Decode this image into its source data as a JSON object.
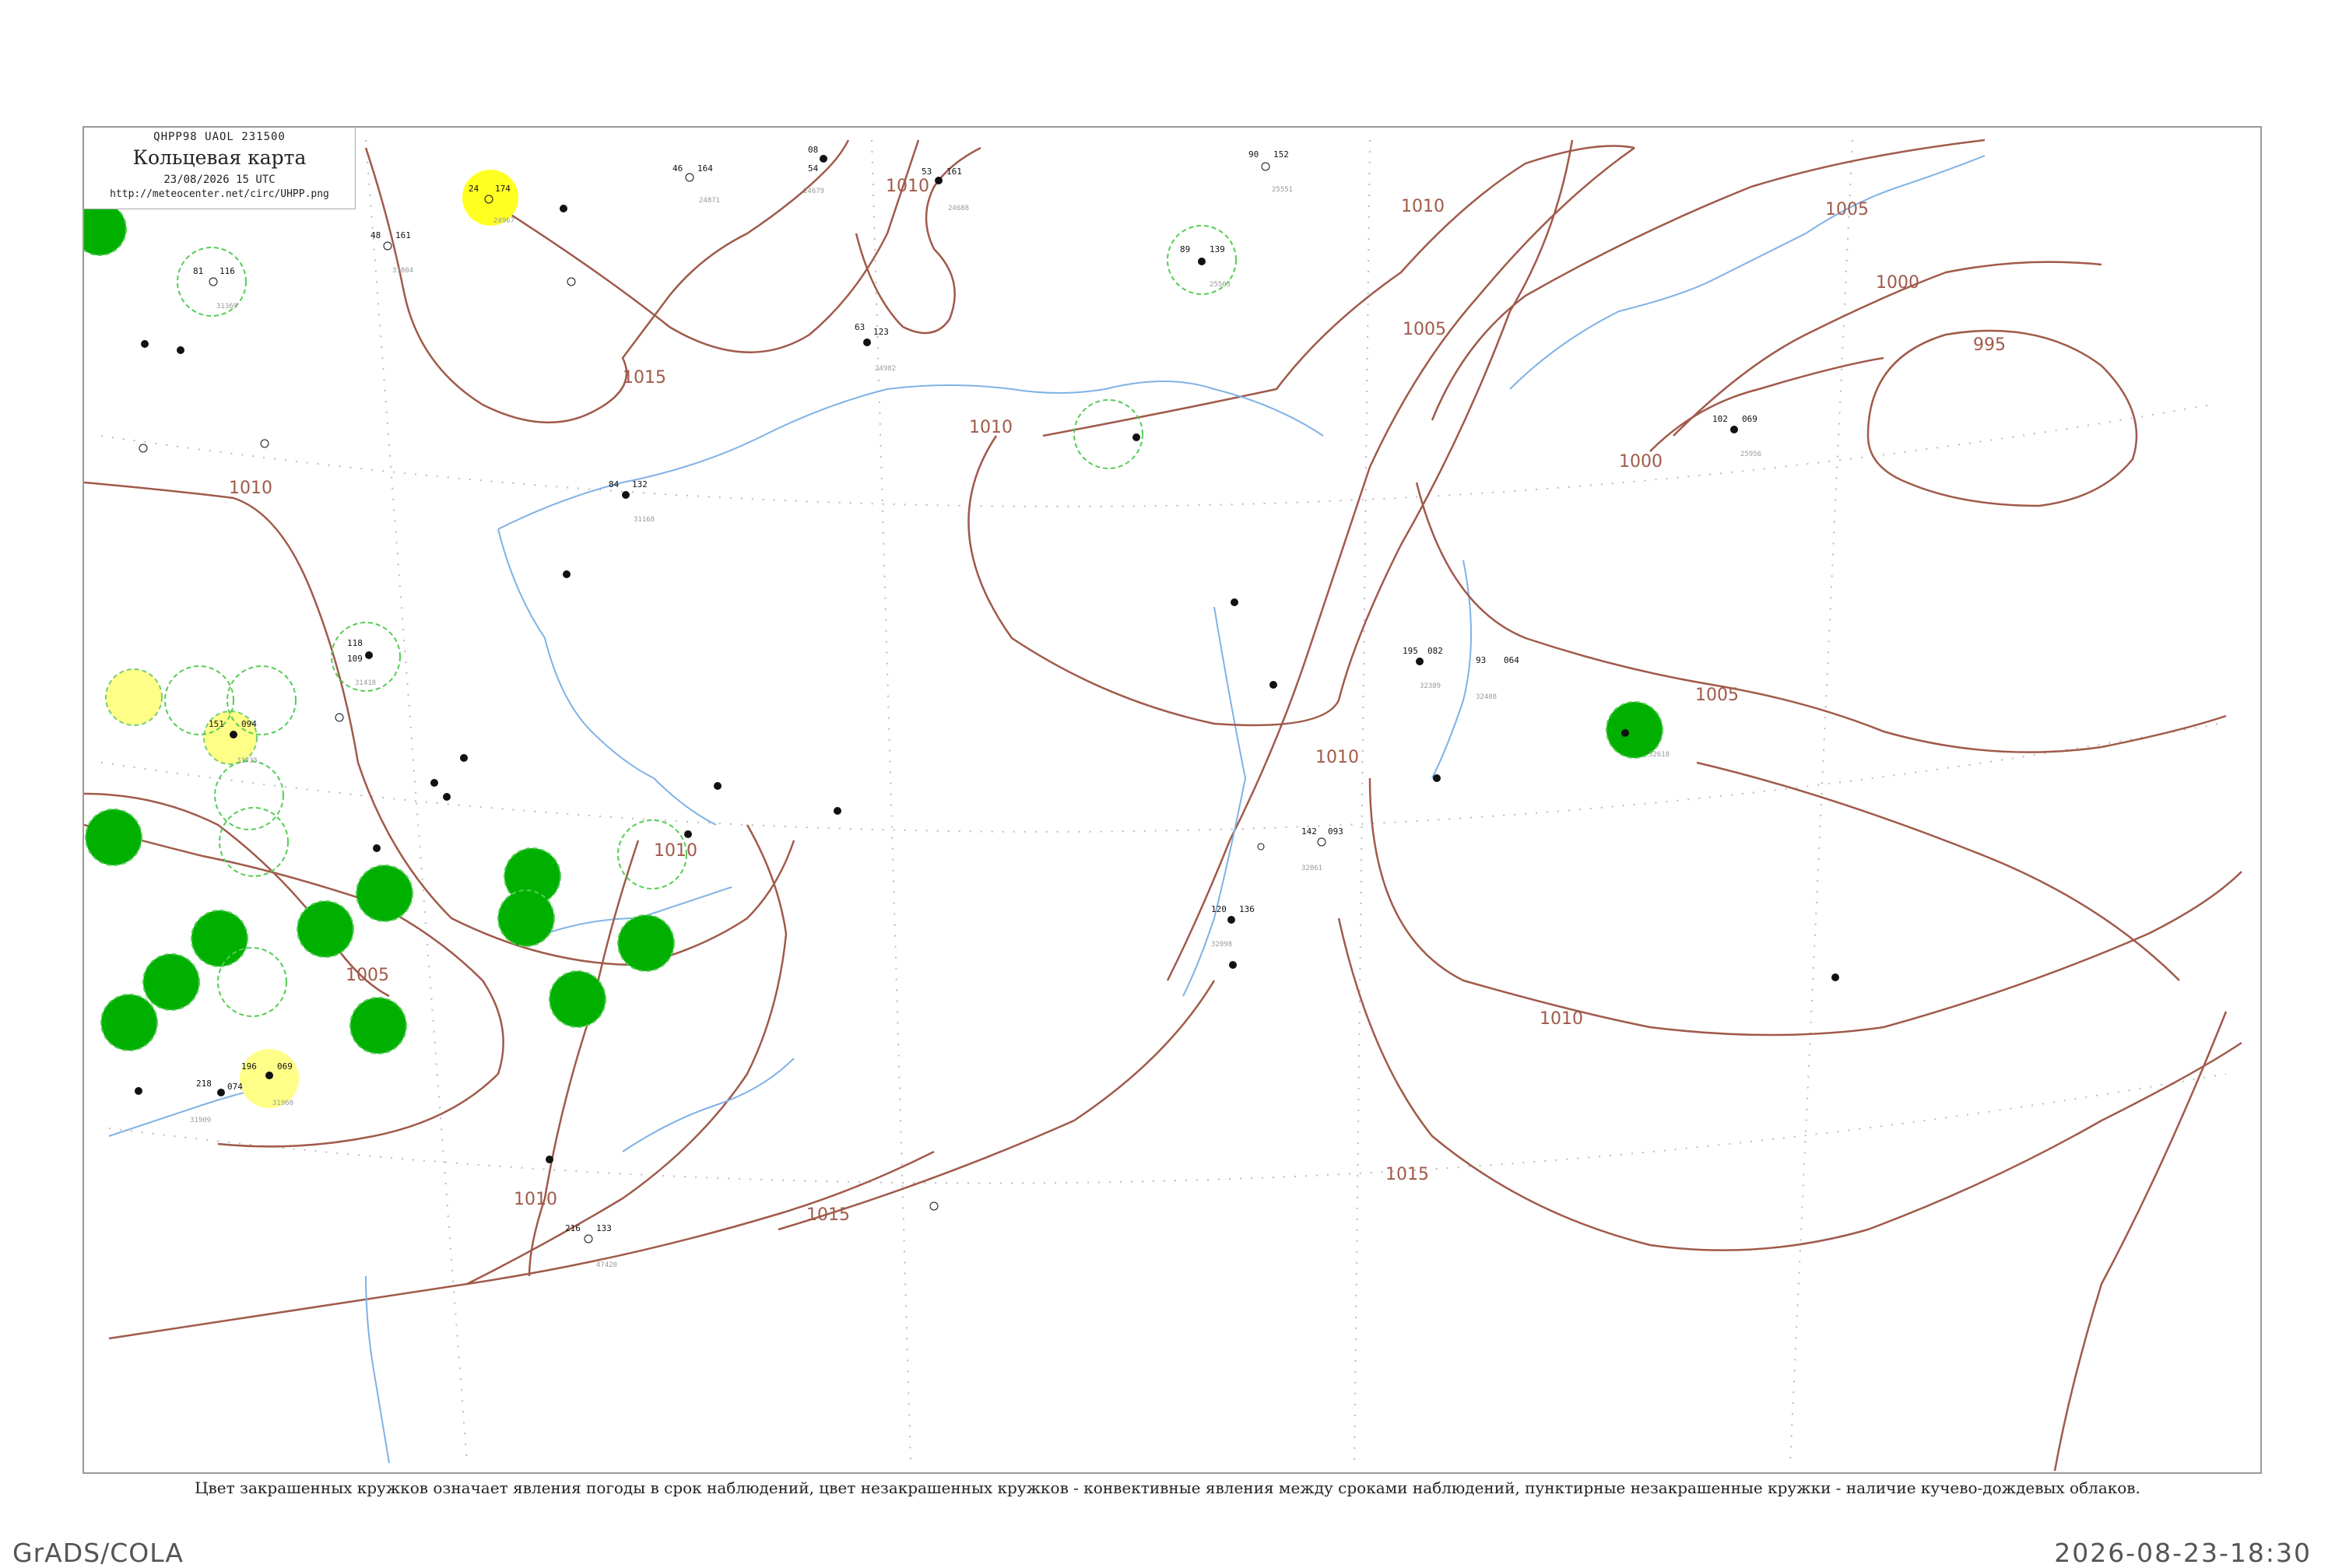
{
  "header": {
    "code": "QHPP98  UAOL  231500",
    "title": "Кольцевая карта",
    "datetime": "23/08/2026 15 UTC",
    "url": "http://meteocenter.net/circ/UHPP.png"
  },
  "isobars": {
    "labels": [
      "1015",
      "1010",
      "1010",
      "1010",
      "1005",
      "1005",
      "1000",
      "995",
      "1000",
      "1005",
      "1010",
      "1010",
      "1015",
      "1010",
      "1015",
      "1010",
      "1005",
      "1010"
    ]
  },
  "stations": [
    {
      "id": "24679",
      "temp": "08",
      "dew": "54",
      "pressure": ""
    },
    {
      "id": "24688",
      "temp": "53",
      "dew": "161",
      "pressure": ""
    },
    {
      "id": "24871",
      "temp": "46",
      "dew": "164",
      "pressure": ""
    },
    {
      "id": "24967",
      "temp": "24",
      "dew": "174",
      "pressure": ""
    },
    {
      "id": "24982",
      "temp": "63",
      "dew": "123",
      "pressure": ""
    },
    {
      "id": "31004",
      "temp": "48",
      "dew": "161",
      "pressure": ""
    },
    {
      "id": "31168",
      "temp": "84",
      "dew": "132",
      "pressure": ""
    },
    {
      "id": "31418",
      "temp": "118",
      "dew": "109",
      "pressure": ""
    },
    {
      "id": "31735",
      "temp": "151",
      "dew": "094",
      "pressure": ""
    },
    {
      "id": "32061",
      "temp": "142",
      "dew": "093",
      "pressure": ""
    },
    {
      "id": "32098",
      "temp": "120",
      "dew": "136",
      "pressure": ""
    },
    {
      "id": "32389",
      "temp": "195",
      "dew": "082",
      "pressure": ""
    },
    {
      "id": "32408",
      "temp": "93",
      "dew": "064",
      "pressure": ""
    },
    {
      "id": "31960",
      "temp": "196",
      "dew": "069",
      "pressure": ""
    },
    {
      "id": "31909",
      "temp": "218",
      "dew": "074",
      "pressure": ""
    },
    {
      "id": "47420",
      "temp": "216",
      "dew": "133",
      "pressure": ""
    },
    {
      "id": "25551",
      "temp": "90",
      "dew": "152",
      "pressure": ""
    },
    {
      "id": "25563",
      "temp": "89",
      "dew": "139",
      "pressure": ""
    },
    {
      "id": "25956",
      "temp": "102",
      "dew": "069",
      "pressure": ""
    },
    {
      "id": "32618",
      "temp": "",
      "dew": "",
      "pressure": ""
    },
    {
      "id": "31369",
      "temp": "81",
      "dew": "116",
      "pressure": ""
    }
  ],
  "legend": {
    "caption": "Цвет закрашенных кружков означает явления погоды в срок наблюдений, цвет незакрашенных кружков - конвективные явления между сроками наблюдений, пунктирные незакрашенные кружки - наличие кучево-дождевых облаков."
  },
  "footer": {
    "left": "GrADS/COLA",
    "right": "2026-08-23-18:30"
  },
  "colors": {
    "isobar": "#a05a4a",
    "river": "#7fb2e5",
    "green_phenomenon": "#00aa00",
    "yellow_phenomenon": "#ffff33",
    "light_yellow_phenomenon": "#ffff88"
  }
}
